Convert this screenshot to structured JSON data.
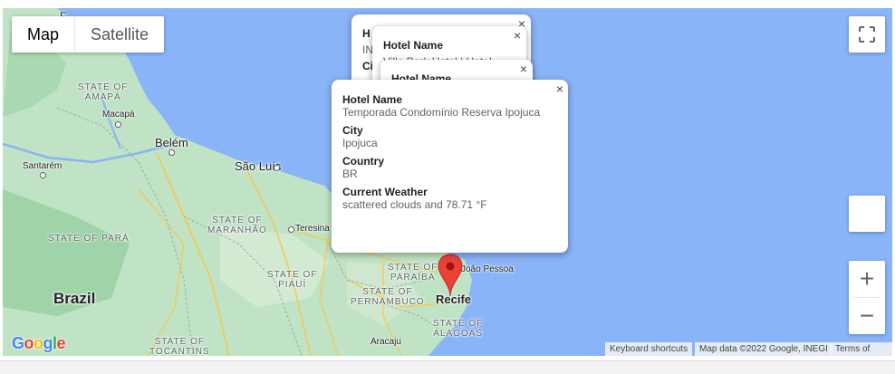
{
  "map_type": {
    "map_label": "Map",
    "satellite_label": "Satellite"
  },
  "labels": {
    "country_brazil": "Brazil",
    "state_amapa": "STATE OF\nAMAPÁ",
    "state_para": "STATE OF PARÁ",
    "state_maranhao": "STATE OF\nMARANHÃO",
    "state_piaui": "STATE OF\nPIAUÍ",
    "state_paraiba": "STATE OF\nPARAÍBA",
    "state_pernambuco": "STATE OF\nPERNAMBUCO",
    "state_alagoas": "STATE OF\nALAGOAS",
    "state_tocantins": "STATE OF\nTOCANTINS",
    "city_macapa": "Macapá",
    "city_belem": "Belém",
    "city_santarem": "Santarém",
    "city_sao_luis": "São Luís",
    "city_teresina": "Teresina",
    "city_joao_pessoa": "João Pessoa",
    "city_recife": "Recife",
    "city_aracaju": "Aracaju",
    "city_top": "F"
  },
  "info_back1": {
    "hotel_heading": "Hotel Name",
    "hotel_partial": "Villa Park Hotel | Hotel",
    "left_h": "H",
    "left_in": "IN",
    "left_ci": "Ci"
  },
  "info_back2": {
    "hotel_heading": "Hotel Name"
  },
  "info_main": {
    "hotel_label": "Hotel Name",
    "hotel_value": "Temporada Condomínio Reserva Ipojuca",
    "city_label": "City",
    "city_value": "Ipojuca",
    "country_label": "Country",
    "country_value": "BR",
    "weather_label": "Current Weather",
    "weather_value": "scattered clouds and 78.71 °F",
    "close": "×"
  },
  "close_symbol": "×",
  "zoom": {
    "in": "+",
    "out": "−"
  },
  "attribution": {
    "keyboard": "Keyboard shortcuts",
    "data": "Map data ©2022 Google, INEGI",
    "terms": "Terms of Use"
  },
  "logo": "Google",
  "colors": {
    "water": "#8ab4f8",
    "land": "#bfe3c4",
    "marker": "#ea4335",
    "roads": "#f9c64e"
  }
}
